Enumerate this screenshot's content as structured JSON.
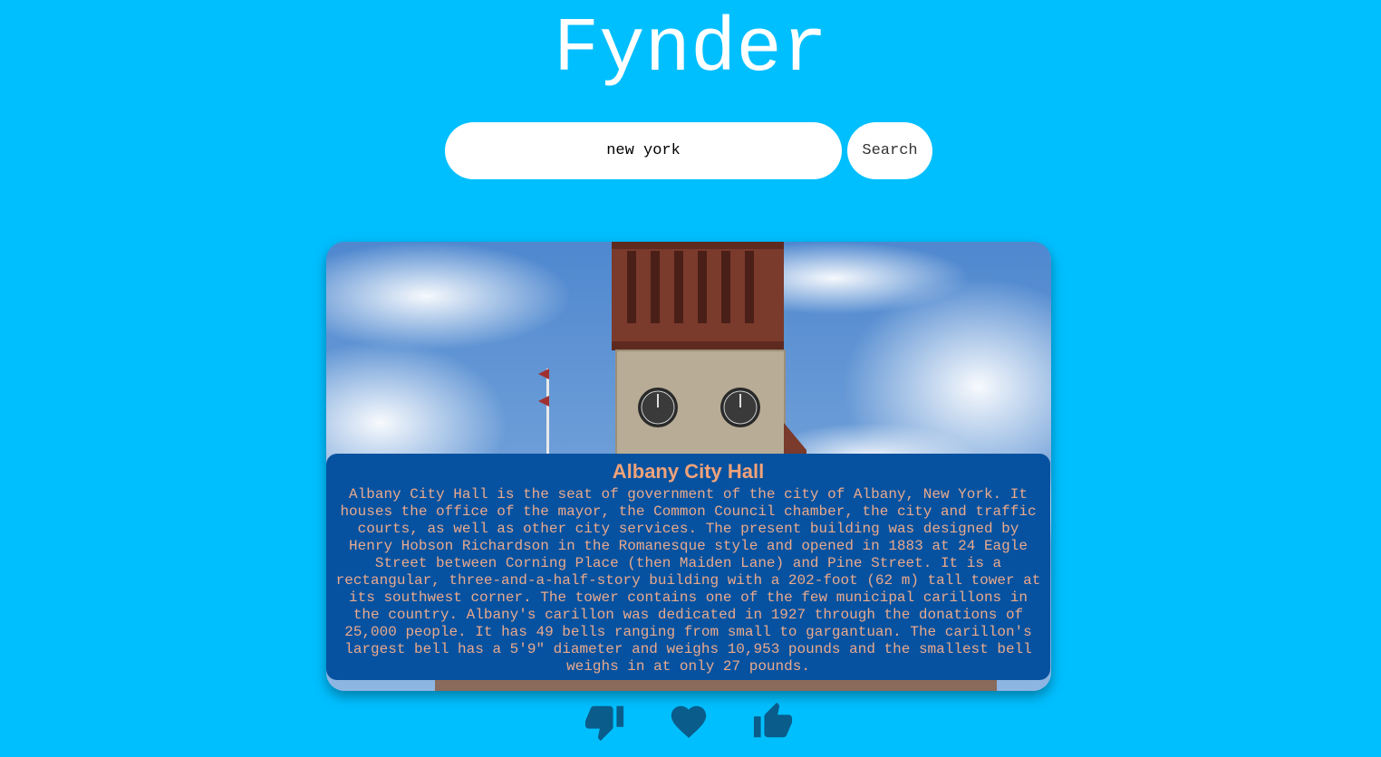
{
  "app": {
    "title": "Fynder"
  },
  "search": {
    "value": "new york",
    "button_label": "Search"
  },
  "card": {
    "title": "Albany City Hall",
    "description": "Albany City Hall is the seat of government of the city of Albany, New York. It houses the office of the mayor, the Common Council chamber, the city and traffic courts, as well as other city services. The present building was designed by Henry Hobson Richardson in the Romanesque style and opened in 1883 at 24 Eagle Street between Corning Place (then Maiden Lane) and Pine Street. It is a rectangular, three-and-a-half-story building with a 202-foot (62 m) tall tower at its southwest corner. The tower contains one of the few municipal carillons in the country. Albany's carillon was dedicated in 1927 through the donations of 25,000 people. It has 49 bells ranging from small to gargantuan. The carillon's largest bell has a 5'9\" diameter and weighs 10,953 pounds and the smallest bell weighs in at only 27 pounds."
  },
  "actions": [
    {
      "icon": "thumbs-down-icon"
    },
    {
      "icon": "heart-icon"
    },
    {
      "icon": "thumbs-up-icon"
    }
  ],
  "colors": {
    "background": "#00bfff",
    "caption_bg": "#0652a0",
    "caption_text": "#e9a98d",
    "icon": "#0a5c8a"
  }
}
